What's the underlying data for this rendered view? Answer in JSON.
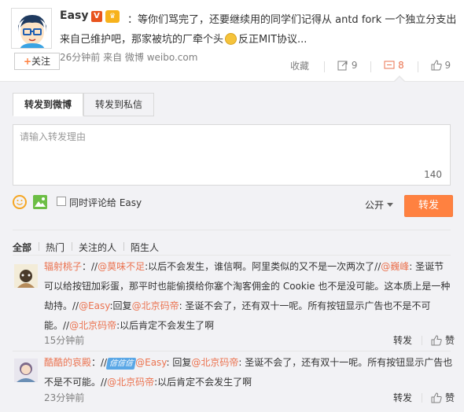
{
  "post": {
    "author": "Easy",
    "badge_v": "V",
    "badge_extra": "♛",
    "text_part1": "：等你们骂完了，还要继续用的同学们记得从 antd fork 一个独立分支出来自己维护吧，那家被坑的厂牵个头",
    "text_part2": "反正MIT协议...",
    "meta": "26分钟前 来自 微博 weibo.com",
    "follow_label": "关注",
    "follow_plus": "+"
  },
  "actions": {
    "favorite": "收藏",
    "repost_count": "9",
    "comment_count": "8",
    "like_count": "9"
  },
  "repost_box": {
    "tabs": [
      "转发到微博",
      "转发到私信"
    ],
    "placeholder": "请输入转发理由",
    "counter": "140",
    "sync_comment_label": "同时评论给 Easy",
    "visibility": "公开",
    "submit": "转发"
  },
  "filters": [
    "全部",
    "热门",
    "关注的人",
    "陌生人"
  ],
  "comments": [
    {
      "user": "辐射桃子",
      "parts": [
        {
          "t": "：//",
          "c": "text"
        },
        {
          "t": "@莫味不足",
          "c": "link"
        },
        {
          "t": ":以后不会发生，谁信啊。阿里类似的又不是一次两次了//",
          "c": "text"
        },
        {
          "t": "@巍峰",
          "c": "link"
        },
        {
          "t": ": 圣诞节可以给按钮加彩蛋，那平时也能偷摸给你塞个淘客佣金的 Cookie 也不是没可能。这本质上是一种劫持。//",
          "c": "text"
        },
        {
          "t": "@Easy",
          "c": "link"
        },
        {
          "t": ":回复",
          "c": "text"
        },
        {
          "t": "@北京码帝",
          "c": "link"
        },
        {
          "t": ": 圣诞不会了，还有双十一呢。所有按钮显示广告也不是不可能。//",
          "c": "text"
        },
        {
          "t": "@北京码帝",
          "c": "link"
        },
        {
          "t": ":以后肯定不会发生了啊",
          "c": "text"
        }
      ],
      "time": "15分钟前",
      "repost": "转发",
      "like": "赞"
    },
    {
      "user": "酷酷的哀殿",
      "badge": "信信信",
      "parts": [
        {
          "t": "：//",
          "c": "text"
        },
        {
          "t": "@Easy",
          "c": "link"
        },
        {
          "t": ": 回复",
          "c": "text"
        },
        {
          "t": "@北京码帝",
          "c": "link"
        },
        {
          "t": ": 圣诞不会了，还有双十一呢。所有按钮显示广告也不是不可能。//",
          "c": "text"
        },
        {
          "t": "@北京码帝",
          "c": "link"
        },
        {
          "t": ":以后肯定不会发生了啊",
          "c": "text"
        }
      ],
      "time": "23分钟前",
      "repost": "转发",
      "like": "赞"
    }
  ],
  "colors": {
    "accent": "#ff8140",
    "link": "#eb7350",
    "gray_bg": "#f2f2f5"
  }
}
